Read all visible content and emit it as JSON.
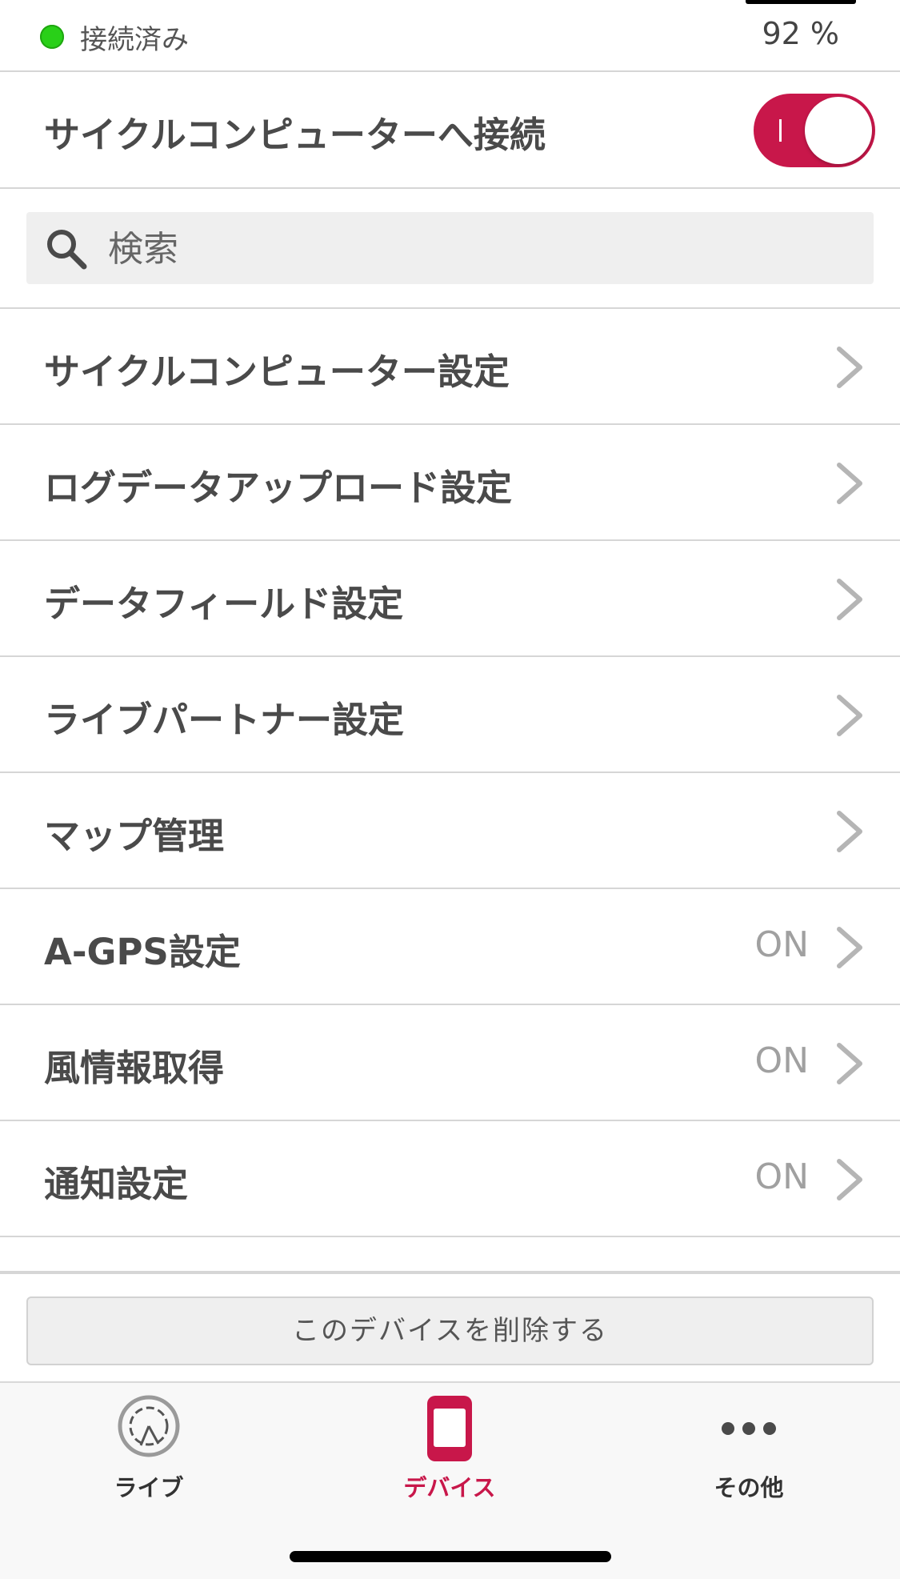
{
  "status": {
    "connection_text": "接続済み",
    "battery": "92 %"
  },
  "connect": {
    "label": "サイクルコンピューターへ接続",
    "enabled": true
  },
  "search": {
    "placeholder": "検索"
  },
  "menu": [
    {
      "label": "サイクルコンピューター設定",
      "value": ""
    },
    {
      "label": "ログデータアップロード設定",
      "value": ""
    },
    {
      "label": "データフィールド設定",
      "value": ""
    },
    {
      "label": "ライブパートナー設定",
      "value": ""
    },
    {
      "label": "マップ管理",
      "value": ""
    },
    {
      "label": "A-GPS設定",
      "value": "ON"
    },
    {
      "label": "風情報取得",
      "value": "ON"
    },
    {
      "label": "通知設定",
      "value": "ON"
    }
  ],
  "delete_button": "このデバイスを削除する",
  "tabs": [
    {
      "label": "ライブ",
      "icon": "live-icon",
      "active": false
    },
    {
      "label": "デバイス",
      "icon": "device-icon",
      "active": true
    },
    {
      "label": "その他",
      "icon": "more-icon",
      "active": false
    }
  ],
  "colors": {
    "accent": "#c8174a",
    "status_connected": "#29d018"
  }
}
